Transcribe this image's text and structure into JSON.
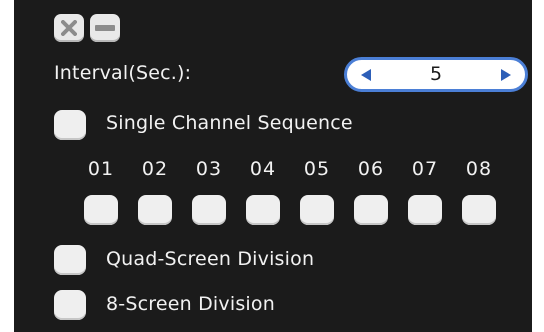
{
  "title_bar": {
    "close_icon": "close-x-icon",
    "minimize_icon": "minimize-icon"
  },
  "interval": {
    "label": "Interval(Sec.):",
    "value": "5",
    "decrement_icon": "left-arrow-icon",
    "increment_icon": "right-arrow-icon",
    "accent_color": "#4b7fd6"
  },
  "single_channel": {
    "label": "Single Channel Sequence",
    "checked": false,
    "channels": [
      "01",
      "02",
      "03",
      "04",
      "05",
      "06",
      "07",
      "08"
    ]
  },
  "quad_screen": {
    "label": "Quad-Screen Division",
    "checked": false
  },
  "eight_screen": {
    "label": "8-Screen Division",
    "checked": false
  },
  "colors": {
    "background": "#1b1b1b",
    "text": "#f2f2f2",
    "control": "#efefef"
  }
}
